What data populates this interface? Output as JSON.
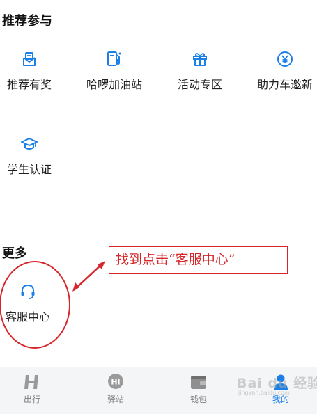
{
  "recommend_section": {
    "title": "推荐参与",
    "items": [
      {
        "label": "推荐有奖",
        "icon": "gift-envelope-icon"
      },
      {
        "label": "哈啰加油站",
        "icon": "fuel-pump-icon"
      },
      {
        "label": "活动专区",
        "icon": "gift-box-icon"
      },
      {
        "label": "助力车邀新",
        "icon": "yen-coin-icon"
      },
      {
        "label": "学生认证",
        "icon": "graduation-cap-icon"
      }
    ]
  },
  "more_section": {
    "title": "更多",
    "items": [
      {
        "label": "客服中心",
        "icon": "headset-icon"
      }
    ]
  },
  "annotation": {
    "text": "找到点击“客服中心”"
  },
  "tabbar": {
    "tabs": [
      {
        "label": "出行",
        "icon": "hello-logo-icon",
        "active": false
      },
      {
        "label": "驿站",
        "icon": "hi-bubble-icon",
        "active": false
      },
      {
        "label": "钱包",
        "icon": "wallet-icon",
        "active": false
      },
      {
        "label": "我的",
        "icon": "profile-icon",
        "active": true
      }
    ]
  },
  "watermark": {
    "text": "Bai du 经验",
    "sub": "jingyan.baidu.com"
  },
  "colors": {
    "accent": "#1a7fe6",
    "annotation_red": "#d6262a",
    "tab_inactive": "#7d7d7d",
    "tabbar_bg": "#f4f5f7"
  }
}
